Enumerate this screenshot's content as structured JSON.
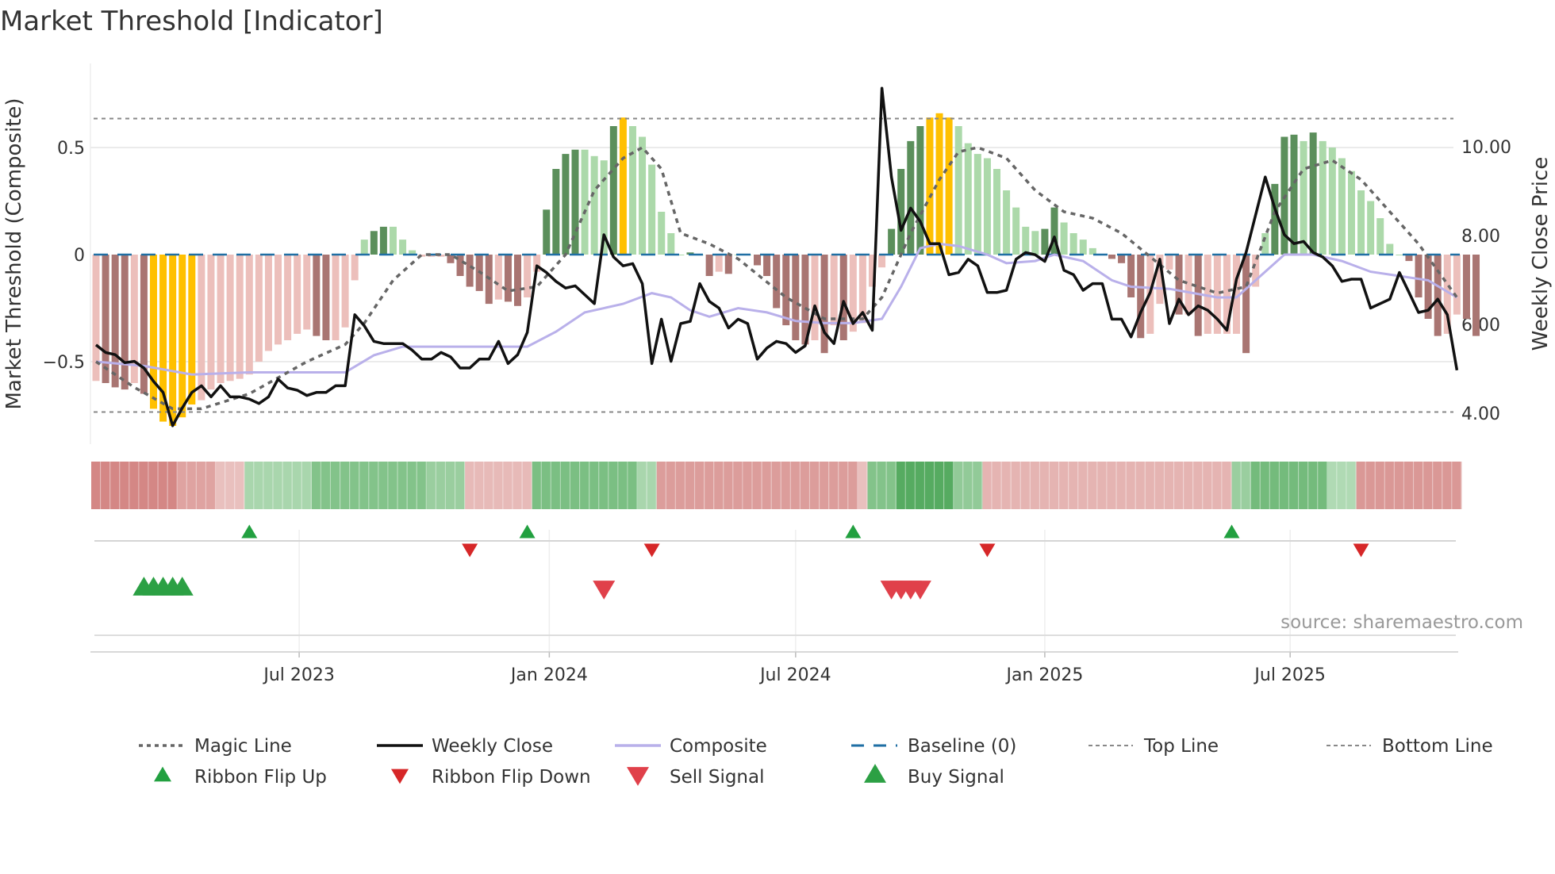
{
  "chart_data": {
    "type": "bar",
    "title": "Market Threshold [Indicator]",
    "ylabel": "Market Threshold (Composite)",
    "y2label": "Weekly Close Price",
    "ylim": [
      -0.87,
      0.9
    ],
    "y2lim": [
      3.3,
      11.5
    ],
    "yticks": [
      {
        "v": 0.5,
        "label": "0.5"
      },
      {
        "v": 0,
        "label": "0"
      },
      {
        "v": -0.5,
        "label": "−0.5"
      }
    ],
    "y2ticks": [
      {
        "v": 10,
        "label": "10.00"
      },
      {
        "v": 8,
        "label": "8.00"
      },
      {
        "v": 6,
        "label": "6.00"
      },
      {
        "v": 4,
        "label": "4.00"
      }
    ],
    "xticks": [
      {
        "week": 21.2,
        "label": "Jul 2023"
      },
      {
        "week": 47.3,
        "label": "Jan 2024"
      },
      {
        "week": 73,
        "label": "Jul 2024"
      },
      {
        "week": 99,
        "label": "Jan 2025"
      },
      {
        "week": 124.6,
        "label": "Jul 2025"
      }
    ],
    "top_line": 0.635,
    "bottom_line": -0.735,
    "baseline": 0,
    "composite_bars": [
      -0.59,
      -0.6,
      -0.62,
      -0.63,
      -0.6,
      -0.65,
      -0.72,
      -0.78,
      -0.8,
      -0.76,
      -0.7,
      -0.68,
      -0.63,
      -0.6,
      -0.59,
      -0.58,
      -0.56,
      -0.5,
      -0.45,
      -0.42,
      -0.4,
      -0.37,
      -0.35,
      -0.38,
      -0.4,
      -0.4,
      -0.34,
      -0.12,
      0.07,
      0.11,
      0.13,
      0.13,
      0.07,
      0.02,
      -0.01,
      -0.01,
      -0.01,
      -0.04,
      -0.1,
      -0.15,
      -0.17,
      -0.23,
      -0.21,
      -0.22,
      -0.24,
      -0.2,
      -0.08,
      0.21,
      0.4,
      0.47,
      0.49,
      0.49,
      0.46,
      0.44,
      0.6,
      0.64,
      0.6,
      0.55,
      0.42,
      0.2,
      0.1,
      0,
      0.01,
      0,
      -0.1,
      -0.08,
      -0.09,
      0,
      0,
      -0.05,
      -0.1,
      -0.25,
      -0.33,
      -0.4,
      -0.42,
      -0.4,
      -0.46,
      -0.33,
      -0.4,
      -0.36,
      -0.32,
      -0.15,
      -0.06,
      0.12,
      0.4,
      0.53,
      0.6,
      0.64,
      0.66,
      0.64,
      0.6,
      0.52,
      0.47,
      0.45,
      0.4,
      0.3,
      0.22,
      0.13,
      0.11,
      0.12,
      0.22,
      0.15,
      0.1,
      0.07,
      0.03,
      0,
      -0.02,
      -0.04,
      -0.2,
      -0.39,
      -0.37,
      -0.23,
      -0.07,
      -0.28,
      -0.28,
      -0.38,
      -0.37,
      -0.37,
      -0.37,
      -0.37,
      -0.46,
      -0.15,
      0.1,
      0.33,
      0.55,
      0.56,
      0.53,
      0.57,
      0.53,
      0.5,
      0.45,
      0.39,
      0.3,
      0.25,
      0.17,
      0.05,
      0,
      -0.03,
      -0.2,
      -0.3,
      -0.38,
      -0.37,
      -0.28,
      -0.3,
      -0.38
    ],
    "weekly_close": [
      5.52,
      5.35,
      5.3,
      5.12,
      5.15,
      5.0,
      4.7,
      4.45,
      3.7,
      4.1,
      4.45,
      4.6,
      4.35,
      4.6,
      4.35,
      4.35,
      4.3,
      4.2,
      4.35,
      4.75,
      4.55,
      4.5,
      4.38,
      4.45,
      4.45,
      4.6,
      4.6,
      6.2,
      5.95,
      5.6,
      5.55,
      5.55,
      5.55,
      5.4,
      5.2,
      5.2,
      5.35,
      5.25,
      5.0,
      5.0,
      5.2,
      5.2,
      5.6,
      5.1,
      5.3,
      5.8,
      7.3,
      7.15,
      6.95,
      6.8,
      6.85,
      6.65,
      6.45,
      8.0,
      7.5,
      7.3,
      7.35,
      6.9,
      5.1,
      6.1,
      5.15,
      6.0,
      6.05,
      6.9,
      6.5,
      6.35,
      5.9,
      6.1,
      6.0,
      5.2,
      5.45,
      5.6,
      5.55,
      5.35,
      5.5,
      6.4,
      5.8,
      5.55,
      6.5,
      6.0,
      6.25,
      5.85,
      11.3,
      9.3,
      8.1,
      8.6,
      8.3,
      7.8,
      7.8,
      7.1,
      7.15,
      7.45,
      7.3,
      6.7,
      6.7,
      6.75,
      7.45,
      7.6,
      7.55,
      7.4,
      7.95,
      7.2,
      7.1,
      6.75,
      6.9,
      6.9,
      6.1,
      6.1,
      5.7,
      6.25,
      6.7,
      7.45,
      6.0,
      6.55,
      6.2,
      6.4,
      6.3,
      6.1,
      5.85,
      7.0,
      7.6,
      8.45,
      9.3,
      8.6,
      8.0,
      7.8,
      7.85,
      7.6,
      7.5,
      7.3,
      6.95,
      7.0,
      7.0,
      6.35,
      6.45,
      6.55,
      7.15,
      6.7,
      6.25,
      6.3,
      6.55,
      6.2,
      4.95
    ],
    "composite_line": [
      [
        0,
        -0.5
      ],
      [
        5,
        -0.52
      ],
      [
        10,
        -0.56
      ],
      [
        16,
        -0.55
      ],
      [
        22,
        -0.55
      ],
      [
        26,
        -0.55
      ],
      [
        29,
        -0.47
      ],
      [
        32,
        -0.43
      ],
      [
        38,
        -0.43
      ],
      [
        45,
        -0.43
      ],
      [
        48,
        -0.36
      ],
      [
        51,
        -0.27
      ],
      [
        55,
        -0.23
      ],
      [
        58,
        -0.18
      ],
      [
        60,
        -0.2
      ],
      [
        62,
        -0.26
      ],
      [
        64,
        -0.29
      ],
      [
        67,
        -0.25
      ],
      [
        70,
        -0.27
      ],
      [
        73,
        -0.31
      ],
      [
        76,
        -0.32
      ],
      [
        79,
        -0.32
      ],
      [
        82,
        -0.3
      ],
      [
        84,
        -0.15
      ],
      [
        86,
        0.03
      ],
      [
        88,
        0.05
      ],
      [
        90,
        0.04
      ],
      [
        93,
        0.0
      ],
      [
        95,
        -0.04
      ],
      [
        98,
        -0.03
      ],
      [
        100,
        0.0
      ],
      [
        103,
        -0.03
      ],
      [
        106,
        -0.12
      ],
      [
        108,
        -0.15
      ],
      [
        112,
        -0.16
      ],
      [
        117,
        -0.2
      ],
      [
        119,
        -0.2
      ],
      [
        121,
        -0.12
      ],
      [
        124,
        0.0
      ],
      [
        127,
        0.0
      ],
      [
        130,
        -0.03
      ],
      [
        133,
        -0.08
      ],
      [
        136,
        -0.1
      ],
      [
        139,
        -0.12
      ],
      [
        142,
        -0.2
      ]
    ],
    "magic_line": [
      [
        0,
        -0.5
      ],
      [
        4,
        -0.62
      ],
      [
        8,
        -0.72
      ],
      [
        11,
        -0.72
      ],
      [
        16,
        -0.65
      ],
      [
        22,
        -0.5
      ],
      [
        26,
        -0.42
      ],
      [
        28,
        -0.32
      ],
      [
        31,
        -0.12
      ],
      [
        34,
        0.0
      ],
      [
        37,
        0.0
      ],
      [
        40,
        -0.08
      ],
      [
        43,
        -0.17
      ],
      [
        46,
        -0.15
      ],
      [
        49,
        0.0
      ],
      [
        52,
        0.3
      ],
      [
        55,
        0.45
      ],
      [
        57,
        0.5
      ],
      [
        59,
        0.4
      ],
      [
        61,
        0.1
      ],
      [
        64,
        0.05
      ],
      [
        67,
        -0.02
      ],
      [
        72,
        -0.2
      ],
      [
        76,
        -0.3
      ],
      [
        80,
        -0.3
      ],
      [
        82,
        -0.2
      ],
      [
        85,
        0.1
      ],
      [
        88,
        0.35
      ],
      [
        90,
        0.48
      ],
      [
        92,
        0.5
      ],
      [
        95,
        0.45
      ],
      [
        98,
        0.3
      ],
      [
        101,
        0.2
      ],
      [
        104,
        0.17
      ],
      [
        107,
        0.1
      ],
      [
        110,
        -0.01
      ],
      [
        113,
        -0.12
      ],
      [
        117,
        -0.18
      ],
      [
        120,
        -0.15
      ],
      [
        123,
        0.2
      ],
      [
        126,
        0.4
      ],
      [
        129,
        0.44
      ],
      [
        132,
        0.35
      ],
      [
        135,
        0.2
      ],
      [
        138,
        0.05
      ],
      [
        142,
        -0.2
      ]
    ],
    "ribbon": [
      {
        "start": 0,
        "end": 8,
        "sign": -1,
        "strength": 0.75
      },
      {
        "start": 9,
        "end": 12,
        "sign": -1,
        "strength": 0.5
      },
      {
        "start": 13,
        "end": 15,
        "sign": -1,
        "strength": 0.25
      },
      {
        "start": 16,
        "end": 22,
        "sign": 1,
        "strength": 0.3
      },
      {
        "start": 23,
        "end": 34,
        "sign": 1,
        "strength": 0.55
      },
      {
        "start": 35,
        "end": 38,
        "sign": 1,
        "strength": 0.4
      },
      {
        "start": 39,
        "end": 45,
        "sign": -1,
        "strength": 0.3
      },
      {
        "start": 46,
        "end": 56,
        "sign": 1,
        "strength": 0.6
      },
      {
        "start": 57,
        "end": 58,
        "sign": 1,
        "strength": 0.3
      },
      {
        "start": 59,
        "end": 79,
        "sign": -1,
        "strength": 0.55
      },
      {
        "start": 80,
        "end": 80,
        "sign": -1,
        "strength": 0.25
      },
      {
        "start": 81,
        "end": 83,
        "sign": 1,
        "strength": 0.55
      },
      {
        "start": 84,
        "end": 89,
        "sign": 1,
        "strength": 0.85
      },
      {
        "start": 90,
        "end": 92,
        "sign": 1,
        "strength": 0.45
      },
      {
        "start": 93,
        "end": 118,
        "sign": -1,
        "strength": 0.35
      },
      {
        "start": 119,
        "end": 120,
        "sign": 1,
        "strength": 0.4
      },
      {
        "start": 121,
        "end": 128,
        "sign": 1,
        "strength": 0.65
      },
      {
        "start": 129,
        "end": 131,
        "sign": 1,
        "strength": 0.25
      },
      {
        "start": 132,
        "end": 142,
        "sign": -1,
        "strength": 0.6
      }
    ],
    "signals": {
      "ribbon_flip_up": [
        16,
        45,
        79,
        118.5
      ],
      "ribbon_flip_down": [
        39,
        58,
        93,
        132
      ],
      "sell_signal": [
        53,
        83,
        84,
        85,
        86
      ],
      "buy_signal": [
        5,
        6,
        7,
        8,
        9
      ]
    },
    "colors": {
      "bar_dark_green": "#5b8f5b",
      "bar_light_green": "#acd9aa",
      "bar_yellow": "#ffc000",
      "bar_dark_red": "#a97572",
      "bar_light_red": "#ecbfbb",
      "close": "#111111",
      "composite": "#b9b0ea",
      "magic": "#666666",
      "baseline": "#1f6fa4",
      "flip_up": "#22a040",
      "flip_down": "#d62728",
      "sell": "#e0404a",
      "buy": "#2ca044"
    },
    "legend": [
      {
        "label": "Magic Line",
        "kind": "dotted"
      },
      {
        "label": "Weekly Close",
        "kind": "solid"
      },
      {
        "label": "Composite",
        "kind": "composite"
      },
      {
        "label": "Baseline (0)",
        "kind": "baseline"
      },
      {
        "label": "Top Line",
        "kind": "thin-dash"
      },
      {
        "label": "Bottom Line",
        "kind": "thin-dash"
      },
      {
        "label": "Ribbon Flip Up",
        "kind": "flip-up"
      },
      {
        "label": "Ribbon Flip Down",
        "kind": "flip-down"
      },
      {
        "label": "Sell Signal",
        "kind": "sell"
      },
      {
        "label": "Buy Signal",
        "kind": "buy"
      }
    ],
    "legend_placement": "bottom",
    "source": "source: sharemaestro.com"
  }
}
